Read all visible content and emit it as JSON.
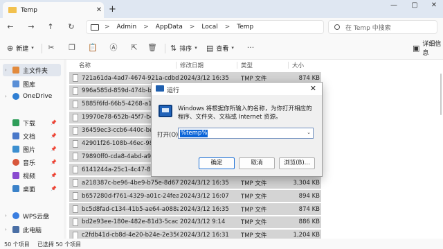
{
  "tab": {
    "title": "Temp",
    "close": "✕",
    "new": "+"
  },
  "window": {
    "minimize": "—",
    "maximize": "▢",
    "close": "✕"
  },
  "nav": {
    "back": "←",
    "forward": "→",
    "up": "↑",
    "refresh": "↻"
  },
  "breadcrumb": [
    "Admin",
    "AppData",
    "Local",
    "Temp"
  ],
  "breadcrumb_sep": ">",
  "search": {
    "placeholder": "在 Temp 中搜索"
  },
  "commands": {
    "new_label": "新建",
    "sort_label": "排序",
    "view_label": "查看",
    "more": "···",
    "details": "详细信息"
  },
  "sidebar": {
    "items": [
      {
        "label": "主文件夹",
        "color": "#e28a3c"
      },
      {
        "label": "图库",
        "color": "#5a8fd6"
      },
      {
        "label": "OneDrive",
        "color": "#2f7fd3"
      },
      {
        "label": "下载",
        "color": "#2f9e5a"
      },
      {
        "label": "文档",
        "color": "#4a79c9"
      },
      {
        "label": "图片",
        "color": "#3c8fd0"
      },
      {
        "label": "音乐",
        "color": "#d8573c"
      },
      {
        "label": "视频",
        "color": "#8a4bd0"
      },
      {
        "label": "桌面",
        "color": "#3b82c9"
      },
      {
        "label": "WPS云盘",
        "color": "#3a7ee0"
      },
      {
        "label": "此电脑",
        "color": "#4a6fa5"
      }
    ],
    "pin": "📌",
    "expand": "›"
  },
  "list": {
    "headers": {
      "name": "名称",
      "date": "修改日期",
      "type": "类型",
      "size": "大小"
    },
    "rows": [
      {
        "name": "721a61da-4ad7-4674-921a-cdbd51b...",
        "date": "2024/3/12 16:35",
        "type": "TMP 文件",
        "size": "874 KB"
      },
      {
        "name": "996a585d-859d-474b-b2a3-2...",
        "date": "",
        "type": "",
        "size": ""
      },
      {
        "name": "5885f6fd-66b5-4268-a1b4-97...",
        "date": "",
        "type": "",
        "size": ""
      },
      {
        "name": "19970e78-652b-45f7-b4fc-ba...",
        "date": "",
        "type": "",
        "size": ""
      },
      {
        "name": "36459ec3-ccb6-440c-becf-6e...",
        "date": "",
        "type": "",
        "size": ""
      },
      {
        "name": "42901f26-108b-46ec-9822-a2...",
        "date": "",
        "type": "",
        "size": ""
      },
      {
        "name": "79890ff0-cda8-4abd-a9be-a6...",
        "date": "",
        "type": "",
        "size": ""
      },
      {
        "name": "6141244a-25c1-4c47-857a-bb...",
        "date": "",
        "type": "",
        "size": ""
      },
      {
        "name": "a218387c-be96-4be9-b75e-8d67fda9...",
        "date": "2024/3/12 16:35",
        "type": "TMP 文件",
        "size": "3,304 KB"
      },
      {
        "name": "b657280d-f761-4329-a01c-24fea59fa...",
        "date": "2024/3/12 16:07",
        "type": "TMP 文件",
        "size": "894 KB"
      },
      {
        "name": "bc5d8fad-c134-41b5-ae64-a088a95b...",
        "date": "2024/3/12 16:35",
        "type": "TMP 文件",
        "size": "874 KB"
      },
      {
        "name": "bd2e93ee-180e-482e-81d3-5cacbb4...",
        "date": "2024/3/12 9:14",
        "type": "TMP 文件",
        "size": "886 KB"
      },
      {
        "name": "c2fdb41d-cb8d-4e20-b24e-2e35699e...",
        "date": "2024/3/12 16:31",
        "type": "TMP 文件",
        "size": "1,204 KB"
      }
    ]
  },
  "status": {
    "count": "50 个项目",
    "selected": "已选择 50 个项目"
  },
  "dialog": {
    "title": "运行",
    "close": "✕",
    "message": "Windows 将根据你所输入的名称，为你打开相应的程序、文件夹、文档或 Internet 资源。",
    "open_label": "打开(O):",
    "input_value": "%temp%",
    "dropdown": "⌄",
    "ok": "确定",
    "cancel": "取消",
    "browse": "浏览(B)..."
  }
}
